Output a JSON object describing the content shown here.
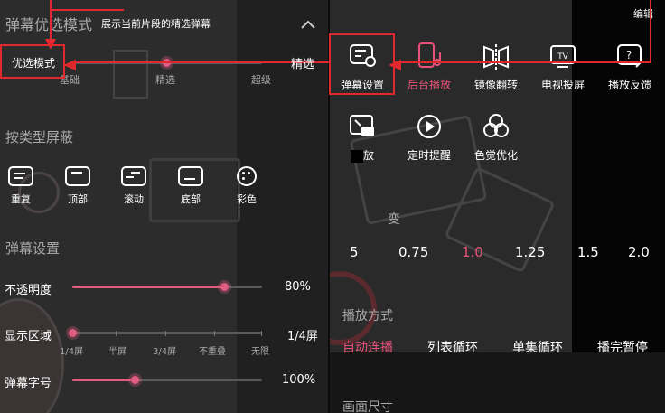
{
  "left": {
    "section_title": "弹幕优选模式",
    "section_desc": "展示当前片段的精选弹幕",
    "mode_button": "优选模式",
    "mode_levels": [
      "基础",
      "精选",
      "超级"
    ],
    "filter_title": "按类型屏蔽",
    "filter_types": [
      {
        "label": "重复",
        "icon": "repeat-danmaku-icon"
      },
      {
        "label": "顶部",
        "icon": "top-danmaku-icon"
      },
      {
        "label": "滚动",
        "icon": "scroll-danmaku-icon"
      },
      {
        "label": "底部",
        "icon": "bottom-danmaku-icon"
      },
      {
        "label": "彩色",
        "icon": "color-palette-icon"
      }
    ],
    "settings_title": "弹幕设置",
    "opacity": {
      "label": "不透明度",
      "value": "80%",
      "fraction": 0.8
    },
    "display_area": {
      "label": "显示区域",
      "value": "1/4屏",
      "ticks": [
        "1/4屏",
        "半屏",
        "3/4屏",
        "不重叠",
        "无限"
      ],
      "fraction": 0
    },
    "font_size": {
      "label": "弹幕字号",
      "value": "100%",
      "fraction": 0.33
    }
  },
  "right": {
    "top_text": "编辑",
    "tools": [
      {
        "label": "弹幕设置",
        "icon": "danmaku-settings-icon",
        "active": false
      },
      {
        "label": "后台播放",
        "icon": "background-play-icon",
        "active": true
      },
      {
        "label": "镜像翻转",
        "icon": "mirror-flip-icon",
        "active": false
      },
      {
        "label": "电视投屏",
        "icon": "tv-cast-icon",
        "active": false
      },
      {
        "label": "播放反馈",
        "icon": "feedback-icon",
        "active": false
      },
      {
        "label": "放",
        "icon": "pip-icon",
        "active": false
      },
      {
        "label": "定时提醒",
        "icon": "timer-icon",
        "active": false
      },
      {
        "label": "色觉优化",
        "icon": "color-vision-icon",
        "active": false
      }
    ],
    "speed_label": "变",
    "speeds": [
      "5",
      "0.75",
      "1.0",
      "1.25",
      "1.5",
      "2.0"
    ],
    "speed_selected": "1.0",
    "play_mode_title": "播放方式",
    "play_modes": [
      "自动连播",
      "列表循环",
      "单集循环",
      "播完暂停"
    ],
    "play_mode_selected": "自动连播",
    "screen_size_title": "画面尺寸"
  },
  "annotation_label": "精选",
  "colors": {
    "accent": "#e8537a",
    "annotation": "#e0282f"
  }
}
